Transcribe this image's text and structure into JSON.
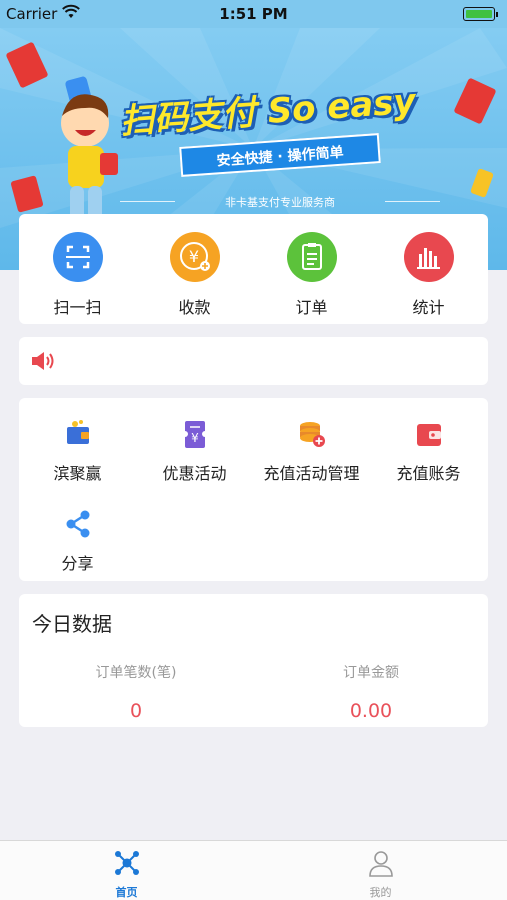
{
  "status_bar": {
    "carrier": "Carrier",
    "time": "1:51 PM",
    "icons": [
      "wifi-icon",
      "battery-icon"
    ],
    "battery_color": "#3fc140"
  },
  "banner": {
    "slogan": "扫码支付 So easy",
    "ribbon": "安全快捷 · 操作简单",
    "subtitle": "非卡基支付专业服务商",
    "background_color": "#84ccf2"
  },
  "quick_actions": [
    {
      "label": "扫一扫",
      "icon": "scan-icon",
      "color": "#3a8ff0"
    },
    {
      "label": "收款",
      "icon": "yuan-coin-icon",
      "color": "#f6a323"
    },
    {
      "label": "订单",
      "icon": "clipboard-icon",
      "color": "#5cc23b"
    },
    {
      "label": "统计",
      "icon": "bar-chart-icon",
      "color": "#e8484f"
    }
  ],
  "notice": {
    "icon": "speaker-icon",
    "text": ""
  },
  "menu": [
    {
      "label": "滨聚赢",
      "icon": "wallet-icon"
    },
    {
      "label": "优惠活动",
      "icon": "coupon-icon"
    },
    {
      "label": "充值活动管理",
      "icon": "coin-stack-icon"
    },
    {
      "label": "充值账务",
      "icon": "red-wallet-icon"
    },
    {
      "label": "分享",
      "icon": "share-icon"
    }
  ],
  "today": {
    "title": "今日数据",
    "order_count_label": "订单笔数(笔)",
    "order_count_value": "0",
    "order_amount_label": "订单金额",
    "order_amount_value": "0.00"
  },
  "tab_bar": {
    "tabs": [
      {
        "label": "首页",
        "icon": "network-hub-icon",
        "active": true
      },
      {
        "label": "我的",
        "icon": "person-icon",
        "active": false
      }
    ],
    "active_color": "#1b78d6"
  }
}
